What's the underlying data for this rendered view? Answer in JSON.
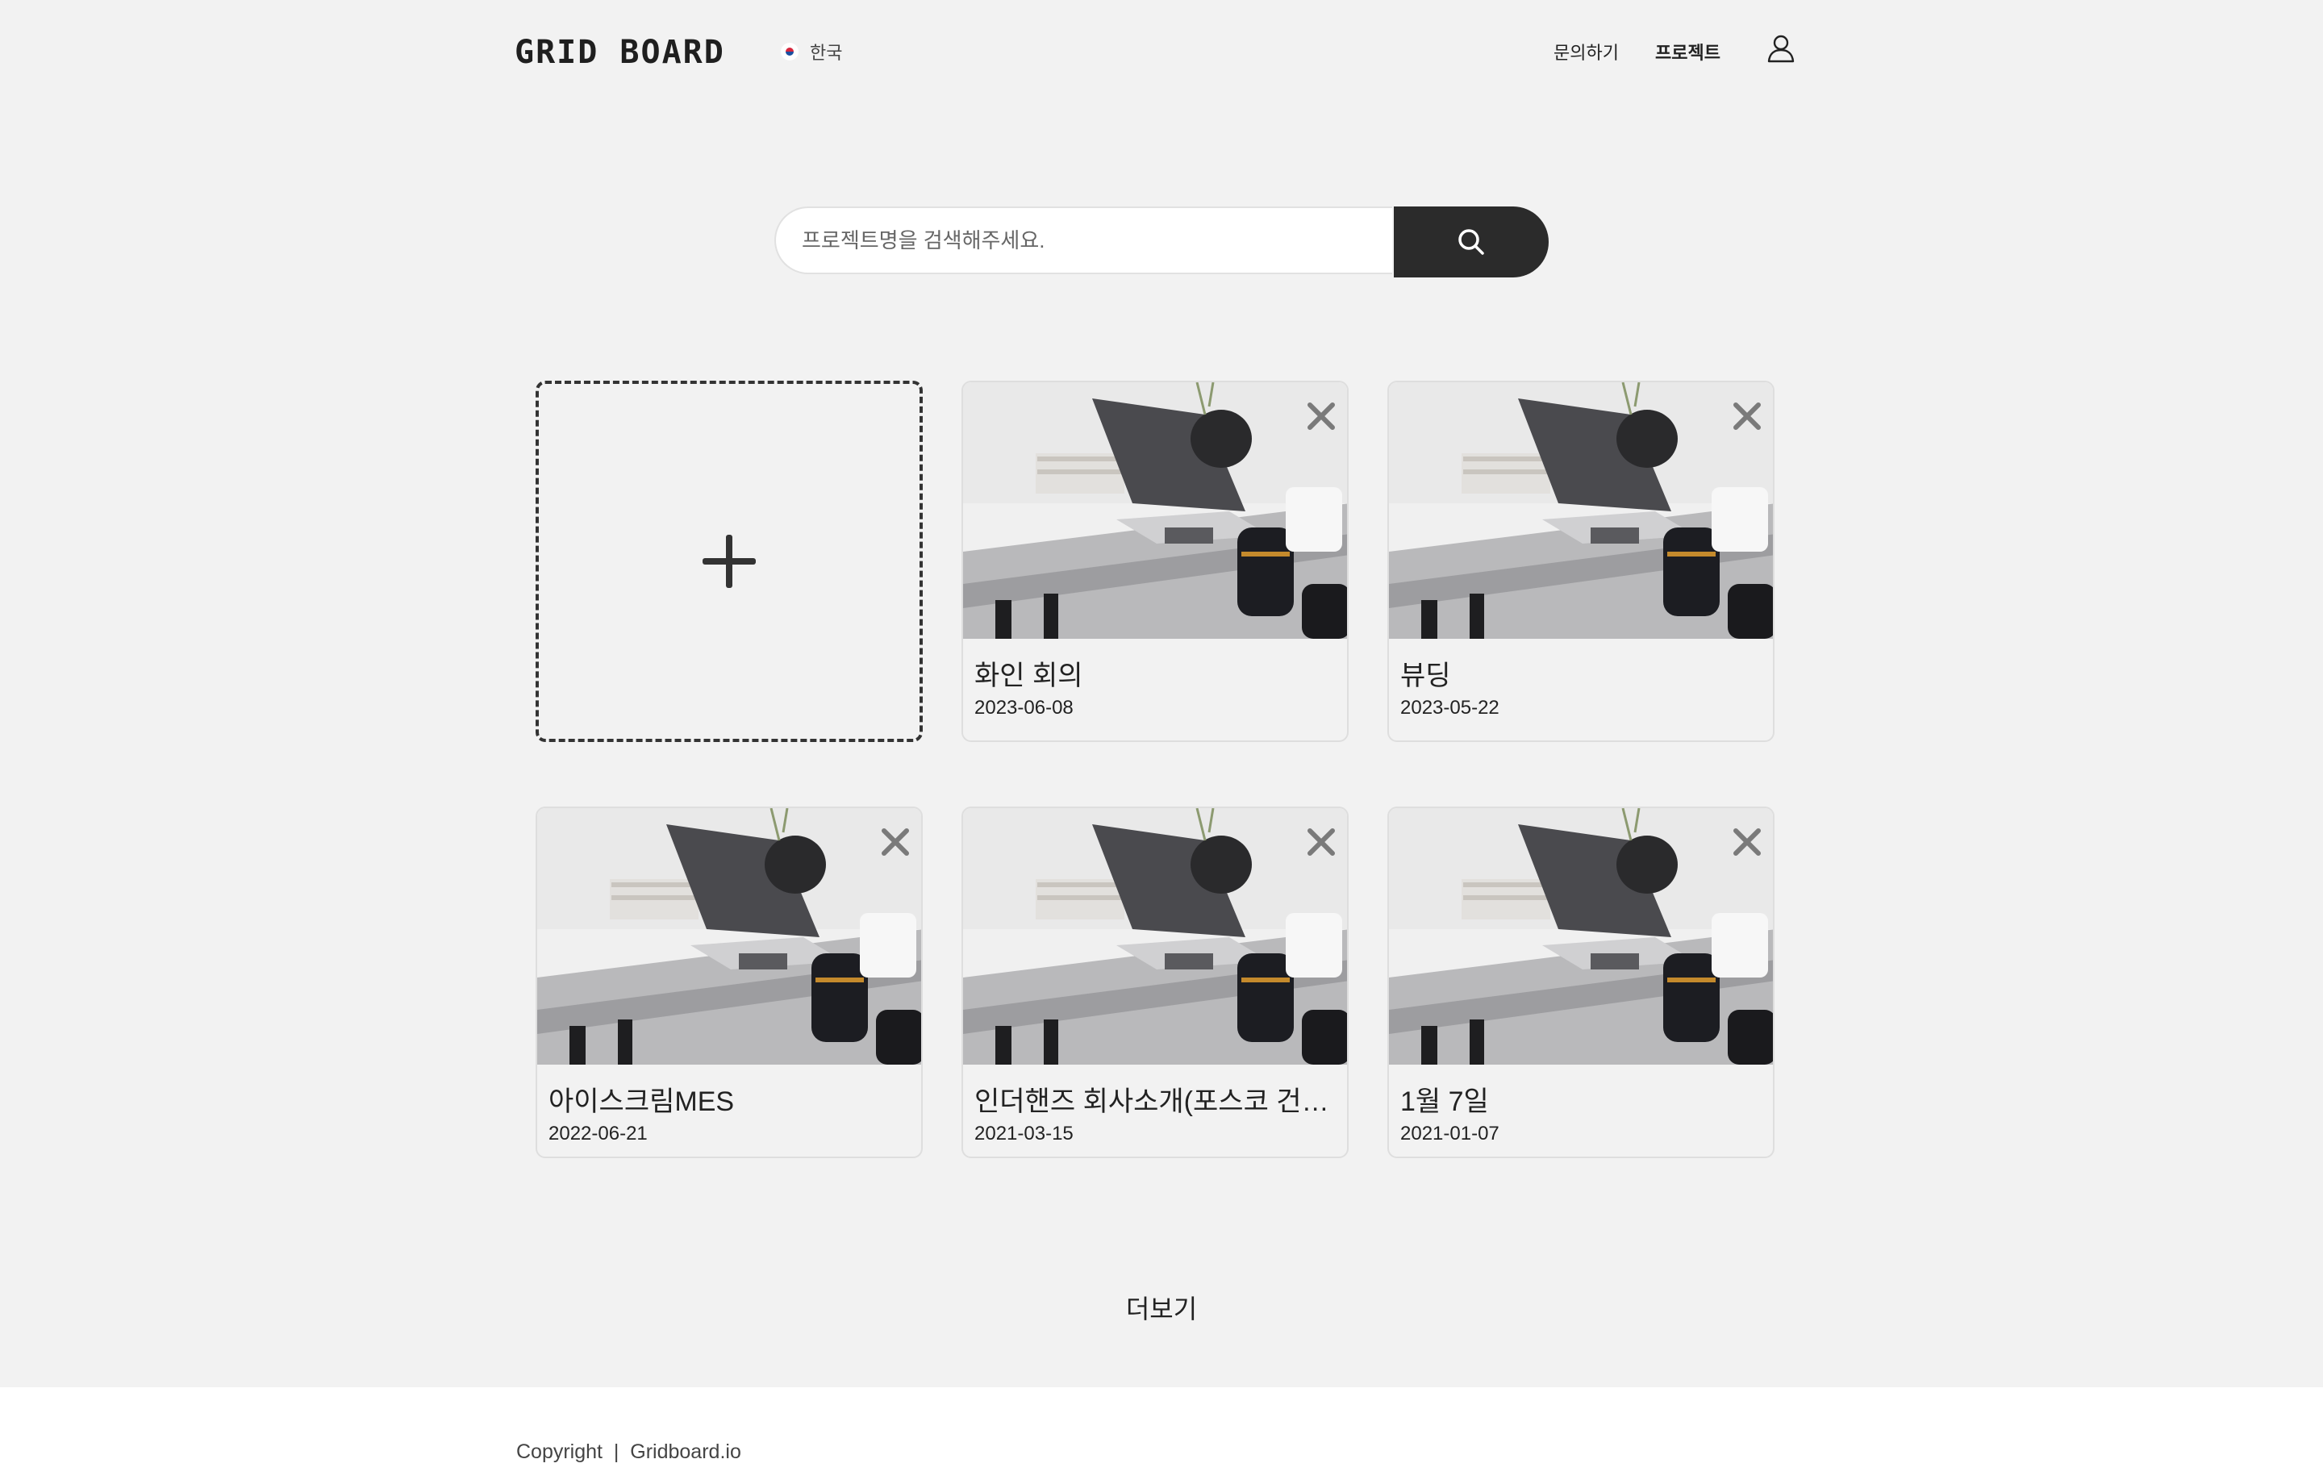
{
  "header": {
    "logo_text": "GRID BOARD",
    "language": "한국",
    "nav": {
      "inquiry": "문의하기",
      "project": "프로젝트"
    }
  },
  "search": {
    "placeholder": "프로젝트명을 검색해주세요.",
    "value": ""
  },
  "projects": [
    {
      "title": "화인 회의",
      "date": "2023-06-08"
    },
    {
      "title": "뷰딩",
      "date": "2023-05-22"
    },
    {
      "title": "아이스크림MES",
      "date": "2022-06-21"
    },
    {
      "title": "인더핸즈 회사소개(포스코 건…",
      "date": "2021-03-15"
    },
    {
      "title": "1월 7일",
      "date": "2021-01-07"
    }
  ],
  "more_label": "더보기",
  "footer": {
    "copyright": "Copyright  |  Gridboard.io"
  },
  "colors": {
    "background": "#f2f2f2",
    "search_button": "#2b2b2b",
    "close_icon": "#7a7a7a"
  }
}
